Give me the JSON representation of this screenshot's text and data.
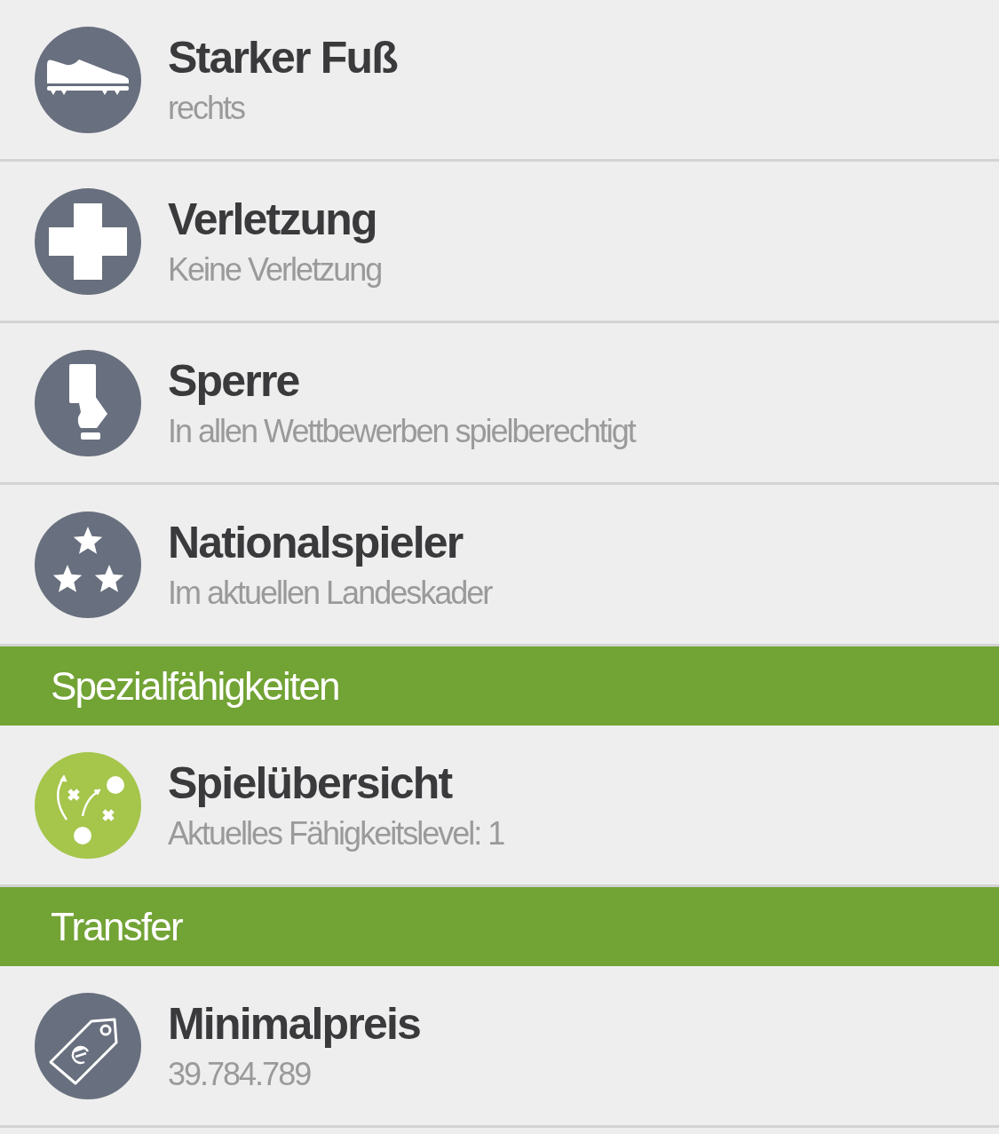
{
  "sections": [
    {
      "items": [
        {
          "kind": "shoe",
          "color": "#686f7e",
          "title": "Starker Fuß",
          "subtitle": "rechts"
        },
        {
          "kind": "cross",
          "color": "#686f7e",
          "title": "Verletzung",
          "subtitle": "Keine Verletzung"
        },
        {
          "kind": "card",
          "color": "#686f7e",
          "title": "Sperre",
          "subtitle": "In allen Wettbewerben spielberechtigt"
        },
        {
          "kind": "stars",
          "color": "#686f7e",
          "title": "Nationalspieler",
          "subtitle": "Im aktuellen Landeskader"
        }
      ]
    },
    {
      "header": "Spezialfähigkeiten",
      "items": [
        {
          "kind": "tactics",
          "color": "#a5c54b",
          "title": "Spielübersicht",
          "subtitle": "Aktuelles Fähigkeitslevel: 1"
        }
      ]
    },
    {
      "header": "Transfer",
      "items": [
        {
          "kind": "tag",
          "color": "#686f7e",
          "title": "Minimalpreis",
          "subtitle": "39.784.789"
        }
      ]
    }
  ]
}
